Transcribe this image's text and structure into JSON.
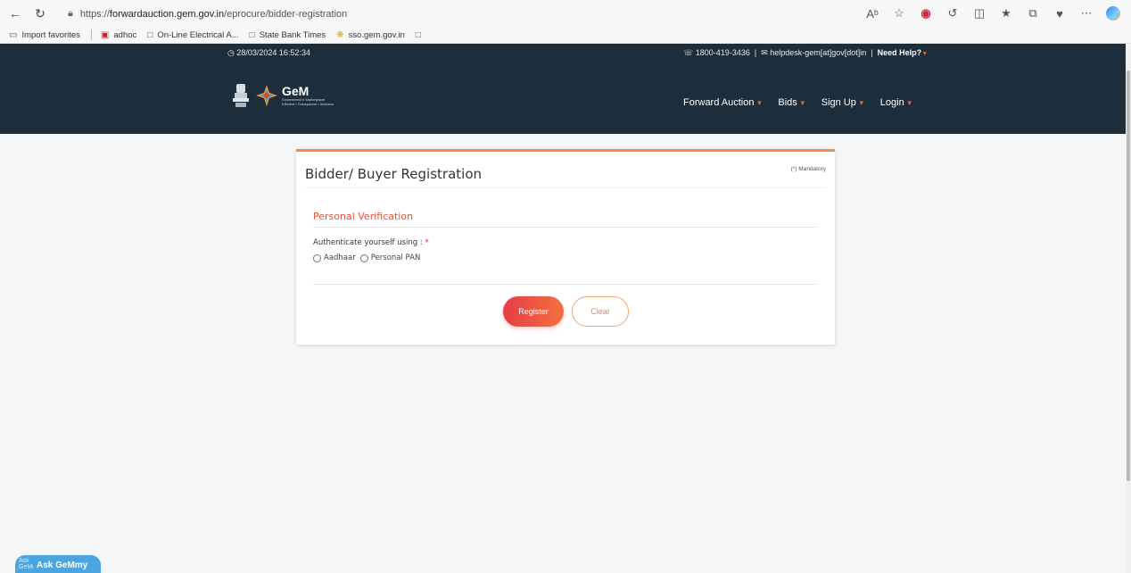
{
  "browser": {
    "url_prefix": "https://",
    "url_host": "forwardauction.gem.gov.in",
    "url_path": "/eprocure/bidder-registration",
    "read_aloud": "Aᵇ"
  },
  "favorites": [
    {
      "label": "Import favorites",
      "icon": "import-icon"
    },
    {
      "label": "adhoc",
      "icon": "pdf-icon"
    },
    {
      "label": "On-Line Electrical A...",
      "icon": "page-icon"
    },
    {
      "label": "State Bank Times",
      "icon": "page-icon"
    },
    {
      "label": "sso.gem.gov.in",
      "icon": "gem-icon"
    },
    {
      "label": "",
      "icon": "page-icon"
    }
  ],
  "header": {
    "datetime": "28/03/2024 16:52:34",
    "phone": "1800-419-3436",
    "email": "helpdesk-gem[at]gov[dot]in",
    "need_help": "Need Help?",
    "logo_text": "GeM",
    "logo_sub": "Government e Marketplace",
    "logo_tagline": "Efficient • Transparent • Inclusive",
    "nav": [
      {
        "label": "Forward Auction"
      },
      {
        "label": "Bids"
      },
      {
        "label": "Sign Up"
      },
      {
        "label": "Login"
      }
    ]
  },
  "form": {
    "title": "Bidder/ Buyer Registration",
    "mandatory_note": "(*) Mandatory",
    "section_title": "Personal Verification",
    "auth_label": "Authenticate yourself using :",
    "required_mark": "*",
    "options": [
      {
        "label": "Aadhaar",
        "selected": false
      },
      {
        "label": "Personal PAN",
        "selected": false
      }
    ],
    "register_label": "Register",
    "clear_label": "Clear"
  },
  "chatbot": {
    "alt_text": "Ask GeMmy",
    "label": "Ask GeMmy"
  },
  "colors": {
    "header_bg": "#1c2e3b",
    "accent": "#e7513b",
    "card_top_border": "#f28c4b"
  }
}
